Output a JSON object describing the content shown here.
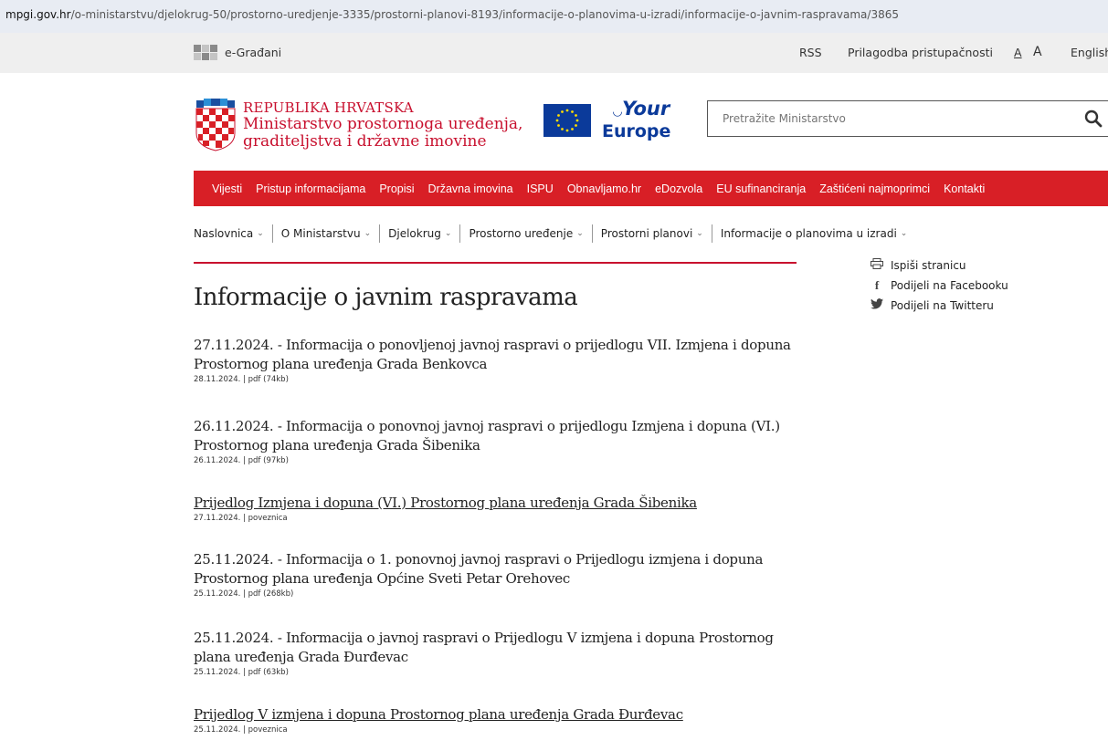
{
  "browser": {
    "url_domain": "mpgi.gov.hr",
    "url_path": "/o-ministarstvu/djelokrug-50/prostorno-uredjenje-3335/prostorni-planovi-8193/informacije-o-planovima-u-izradi/informacije-o-javnim-raspravama/3865"
  },
  "topbar": {
    "egradjani": "e-Građani",
    "rss": "RSS",
    "accessibility": "Prilagodba pristupačnosti",
    "font_small": "A",
    "font_large": "A",
    "language": "English"
  },
  "header": {
    "line1": "REPUBLIKA HRVATSKA",
    "line2": "Ministarstvo prostornoga uređenja,",
    "line3": "graditeljstva i državne imovine",
    "your": "Your",
    "europe": "Europe",
    "search_placeholder": "Pretražite Ministarstvo"
  },
  "mainnav": [
    "Vijesti",
    "Pristup informacijama",
    "Propisi",
    "Državna imovina",
    "ISPU",
    "Obnavljamo.hr",
    "eDozvola",
    "EU sufinanciranja",
    "Zaštićeni najmoprimci",
    "Kontakti"
  ],
  "breadcrumbs": [
    "Naslovnica",
    "O Ministarstvu",
    "Djelokrug",
    "Prostorno uređenje",
    "Prostorni planovi",
    "Informacije o planovima u izradi"
  ],
  "page": {
    "title": "Informacije o javnim raspravama"
  },
  "share": {
    "print": "Ispiši stranicu",
    "facebook": "Podijeli na Facebooku",
    "twitter": "Podijeli na Twitteru"
  },
  "items": [
    {
      "title": "27.11.2024. - Informacija o ponovljenoj javnoj raspravi o prijedlogu VII. Izmjena i dopuna Prostornog plana uređenja Grada Benkovca",
      "meta": "28.11.2024. | pdf (74kb)"
    },
    {
      "title": "26.11.2024. - Informacija o ponovnoj javnoj raspravi o prijedlogu Izmjena i dopuna (VI.) Prostornog plana uređenja Grada Šibenika",
      "meta": "26.11.2024. | pdf (97kb)"
    },
    {
      "title": "Prijedlog Izmjena i dopuna (VI.) Prostornog plana uređenja Grada Šibenika",
      "meta": "27.11.2024. | poveznica"
    },
    {
      "title": "25.11.2024. - Informacija o 1. ponovnoj javnoj raspravi o Prijedlogu izmjena i dopuna Prostornog plana uređenja Općine Sveti Petar Orehovec",
      "meta": "25.11.2024. | pdf (268kb)"
    },
    {
      "title": "25.11.2024. - Informacija o javnoj raspravi o Prijedlogu V izmjena i dopuna Prostornog plana uređenja Grada Đurđevac",
      "meta": "25.11.2024. | pdf (63kb)"
    },
    {
      "title": "Prijedlog V izmjena i dopuna Prostornog plana uređenja Grada Đurđevac",
      "meta": "25.11.2024. | poveznica"
    }
  ],
  "colors": {
    "brand_red": "#d81f26",
    "eu_blue": "#0b3a9a"
  }
}
